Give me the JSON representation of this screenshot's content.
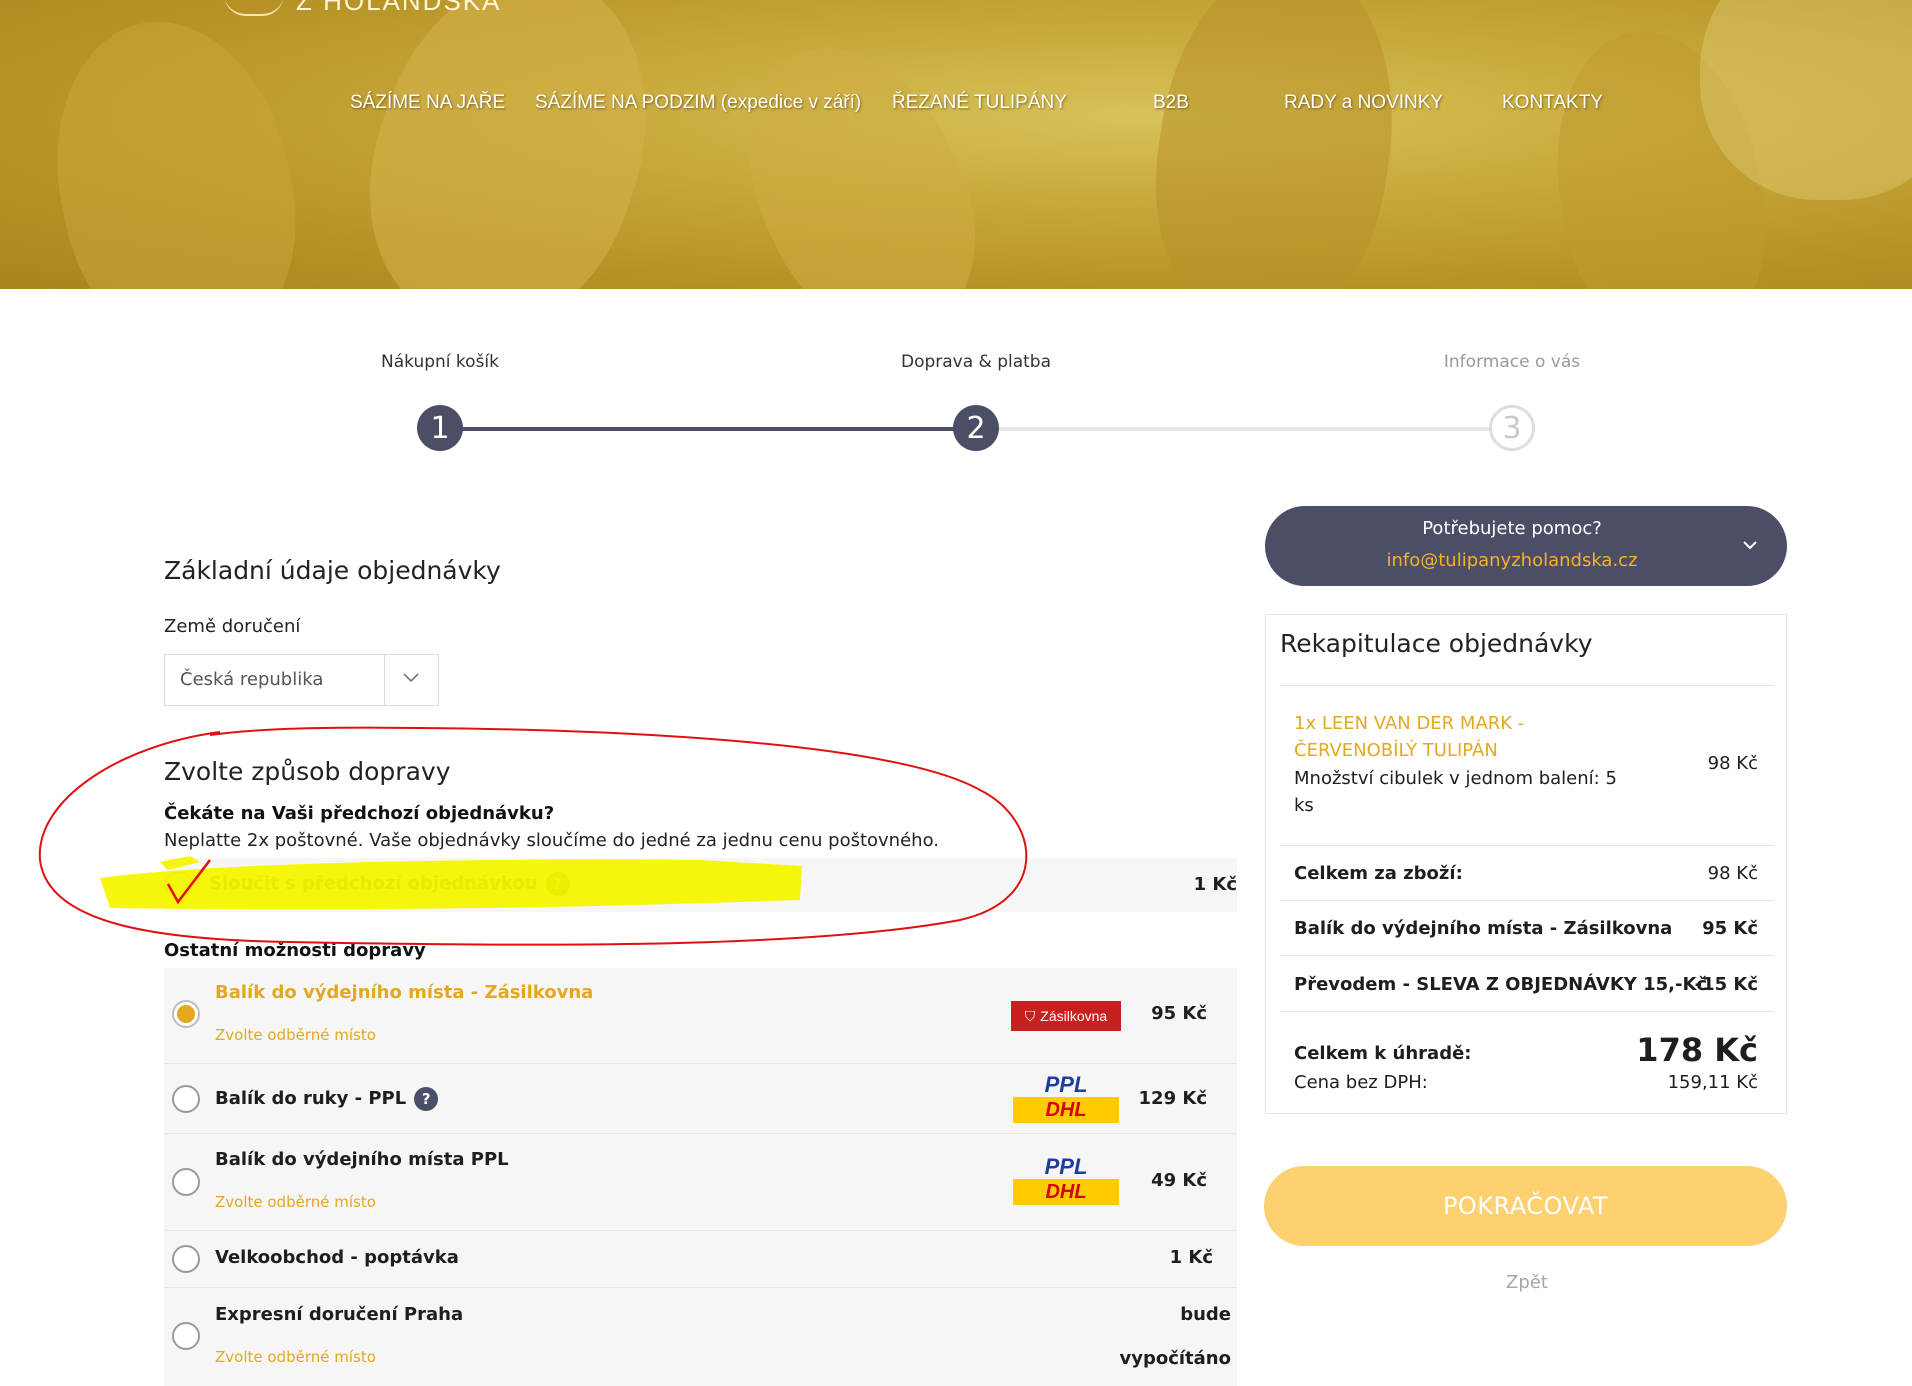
{
  "header": {
    "logo_text": "Z HOLANDSKA",
    "nav": [
      {
        "label": "SÁZÍME NA JAŘE"
      },
      {
        "label": "SÁZÍME NA PODZIM (expedice v září)"
      },
      {
        "label": "ŘEZANÉ TULIPÁNY"
      },
      {
        "label": "B2B"
      },
      {
        "label": "RADY a NOVINKY"
      },
      {
        "label": "KONTAKTY"
      }
    ]
  },
  "stepper": {
    "steps": [
      {
        "label": "Nákupní košík",
        "number": "1",
        "state": "done"
      },
      {
        "label": "Doprava & platba",
        "number": "2",
        "state": "current"
      },
      {
        "label": "Informace o vás",
        "number": "3",
        "state": "todo"
      }
    ],
    "active_color": "#4b4e66",
    "inactive_color": "#dcdcdc"
  },
  "order_basics": {
    "title": "Základní údaje objednávky",
    "country_label": "Země doručení",
    "country_value": "Česká republika"
  },
  "shipping": {
    "title": "Zvolte způsob dopravy",
    "merge_question": "Čekáte na Vaši předchozí objednávku?",
    "merge_info": "Neplatte 2x poštovné. Vaše objednávky sloučíme do jedné za jednu cenu poštovného.",
    "merge_option": {
      "label": "Sloučit s předchozí objednávkou",
      "price": "1 Kč",
      "help": "?"
    },
    "other_title": "Ostatní možnosti dopravy",
    "options": [
      {
        "title": "Balík do výdejního místa - Zásilkovna",
        "sub": "Zvolte odběrné místo",
        "price": "95 Kč",
        "logo": "Zásilkovna",
        "selected": true
      },
      {
        "title": "Balík do ruky - PPL",
        "sub": "",
        "price": "129 Kč",
        "logo_top": "PPL",
        "logo_bottom": "DHL",
        "help": "?",
        "selected": false
      },
      {
        "title": "Balík do výdejního místa PPL",
        "sub": "Zvolte odběrné místo",
        "price": "49 Kč",
        "logo_top": "PPL",
        "logo_bottom": "DHL",
        "selected": false
      },
      {
        "title": "Velkoobchod - poptávka",
        "sub": "",
        "price": "1 Kč",
        "selected": false
      },
      {
        "title": "Expresní doručení Praha",
        "sub": "Zvolte odběrné místo",
        "price_line1": "bude",
        "price_line2": "vypočítáno",
        "selected": false
      }
    ],
    "accent_color": "#e3a81f"
  },
  "help_box": {
    "title": "Potřebujete pomoc?",
    "email": "info@tulipanyzholandska.cz"
  },
  "recap": {
    "title": "Rekapitulace objednávky",
    "item": {
      "name_line1": "1x LEEN VAN DER MARK -",
      "name_line2": "ČERVENOBÍLÝ TULIPÁN",
      "detail_line1": "Množství cibulek v jednom balení: 5",
      "detail_line2": "ks",
      "price": "98 Kč"
    },
    "rows": [
      {
        "label": "Celkem za zboží:",
        "value": "98 Kč"
      },
      {
        "label": "Balík do výdejního místa - Zásilkovna",
        "value": "95 Kč"
      },
      {
        "label": "Převodem - SLEVA Z OBJEDNÁVKY 15,-Kč",
        "value": "-15 Kč"
      }
    ],
    "total_label": "Celkem k úhradě:",
    "total_value": "178 Kč",
    "net_label": "Cena bez DPH:",
    "net_value": "159,11 Kč"
  },
  "actions": {
    "continue_label": "POKRAČOVAT",
    "back_label": "Zpět"
  }
}
